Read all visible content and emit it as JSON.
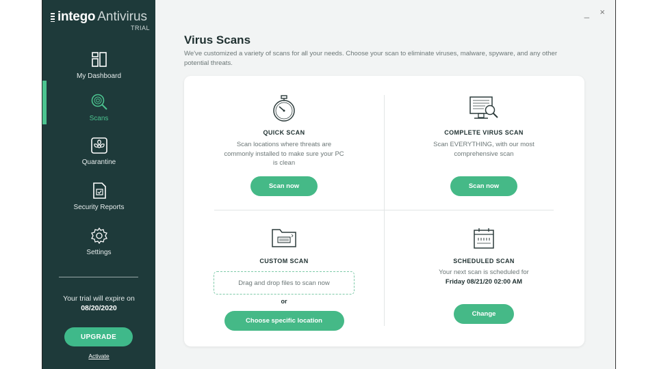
{
  "brand": {
    "name": "intego",
    "product": "Antivirus",
    "edition": "TRIAL"
  },
  "sidebar": {
    "items": [
      {
        "label": "My Dashboard",
        "icon": "dashboard-icon"
      },
      {
        "label": "Scans",
        "icon": "fingerprint-search-icon",
        "active": true
      },
      {
        "label": "Quarantine",
        "icon": "biohazard-icon"
      },
      {
        "label": "Security Reports",
        "icon": "report-icon"
      },
      {
        "label": "Settings",
        "icon": "gear-icon"
      }
    ],
    "trial_text": "Your trial will expire on",
    "trial_date": "08/20/2020",
    "upgrade_label": "UPGRADE",
    "activate_label": "Activate"
  },
  "window": {
    "minimize": "_",
    "close": "×"
  },
  "main": {
    "title": "Virus Scans",
    "description": "We've customized a variety of scans for all your needs. Choose your scan to eliminate viruses, malware, spyware, and any other potential threats.",
    "quick": {
      "title": "QUICK SCAN",
      "desc": "Scan locations where threats are commonly installed to make sure your PC is clean",
      "button": "Scan now",
      "icon": "stopwatch-icon"
    },
    "complete": {
      "title": "COMPLETE VIRUS SCAN",
      "desc": "Scan EVERYTHING, with our most comprehensive scan",
      "button": "Scan now",
      "icon": "monitor-search-icon"
    },
    "custom": {
      "title": "CUSTOM SCAN",
      "drop": "Drag and drop files to scan now",
      "or": "or",
      "button": "Choose specific location",
      "icon": "folder-icon"
    },
    "scheduled": {
      "title": "SCHEDULED SCAN",
      "desc": "Your next scan is scheduled for",
      "date": "Friday 08/21/20 02:00 AM",
      "button": "Change",
      "icon": "calendar-icon"
    }
  },
  "colors": {
    "sidebar": "#1e3a3a",
    "accent": "#45b987",
    "background": "#f2f4f4"
  }
}
